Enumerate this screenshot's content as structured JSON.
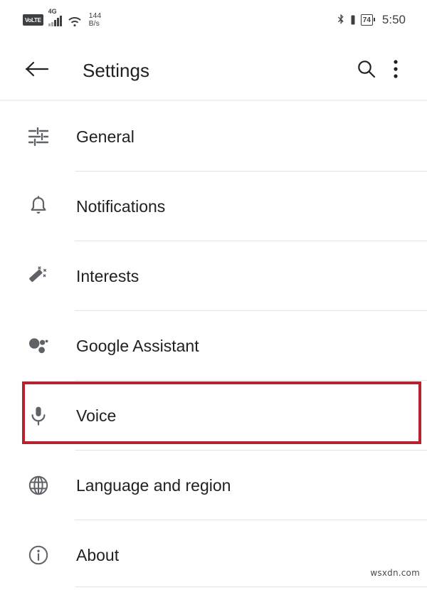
{
  "status_bar": {
    "volte_label": "VoLTE",
    "network_type": "4G",
    "net_speed_value": "144",
    "net_speed_unit": "B/s",
    "wifi_icon": "wifi-icon",
    "bluetooth_icon": "bluetooth-icon",
    "vibrate_icon": "vibrate-icon",
    "battery_percent": "74",
    "time": "5:50"
  },
  "app_bar": {
    "back_icon": "arrow-back-icon",
    "title": "Settings",
    "search_icon": "search-icon",
    "overflow_icon": "more-vert-icon"
  },
  "list": {
    "items": [
      {
        "label": "General",
        "icon": "tune-sliders-icon",
        "highlighted": false
      },
      {
        "label": "Notifications",
        "icon": "bell-icon",
        "highlighted": false
      },
      {
        "label": "Interests",
        "icon": "magic-wand-icon",
        "highlighted": false
      },
      {
        "label": "Google Assistant",
        "icon": "google-assistant-icon",
        "highlighted": false
      },
      {
        "label": "Voice",
        "icon": "microphone-icon",
        "highlighted": true
      },
      {
        "label": "Language and region",
        "icon": "globe-icon",
        "highlighted": false
      },
      {
        "label": "About",
        "icon": "info-circle-icon",
        "highlighted": false
      }
    ]
  },
  "annotation": {
    "highlight_color": "#b5232e",
    "highlight_target": "Voice"
  },
  "watermark": {
    "text": "wsxdn.com"
  }
}
